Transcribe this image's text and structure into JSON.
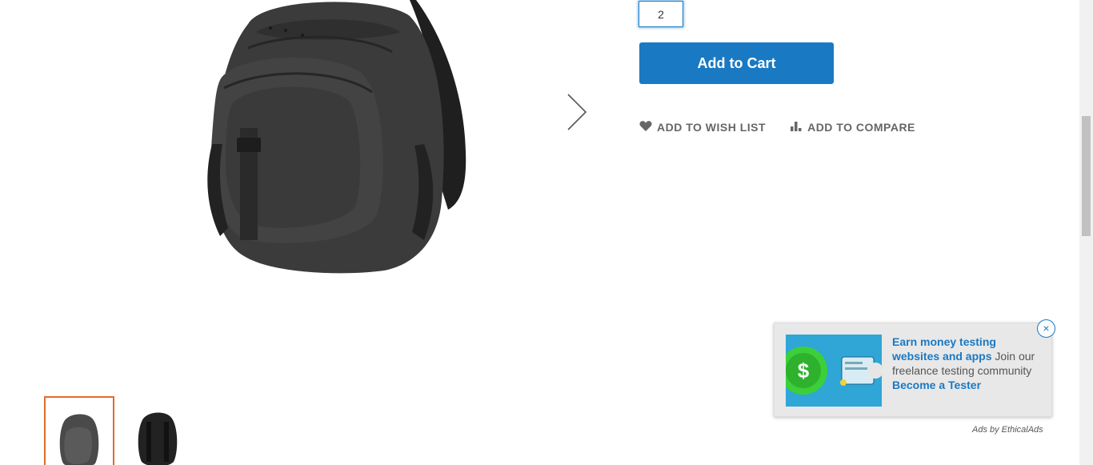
{
  "product": {
    "qty_value": "2",
    "add_to_cart_label": "Add to Cart",
    "wishlist_label": "ADD TO WISH LIST",
    "compare_label": "ADD TO COMPARE"
  },
  "gallery": {
    "thumbnails": [
      "backpack-front",
      "backpack-back"
    ],
    "active_thumbnail": 0
  },
  "ad": {
    "headline": "Earn money testing websites and apps",
    "body": " Join our freelance testing community ",
    "cta": "Become a Tester",
    "close_glyph": "×",
    "attribution": "Ads by EthicalAds"
  },
  "colors": {
    "primary": "#1979c3",
    "active_thumb_border": "#e36b2c"
  }
}
